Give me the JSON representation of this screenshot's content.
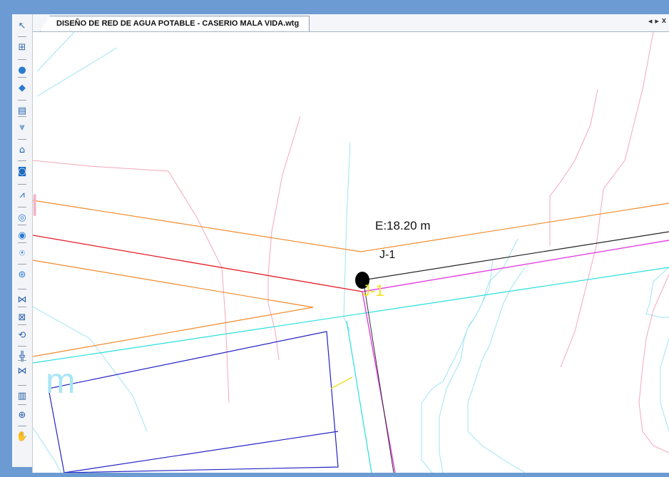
{
  "window": {
    "tab_title": "DISEÑO DE RED DE AGUA POTABLE - CASERIO MALA VIDA.wtg",
    "tab_controls": [
      "◂",
      "▸",
      "x"
    ]
  },
  "toolbar": {
    "tools": [
      {
        "name": "select-pointer-icon",
        "glyph": "↖"
      },
      {
        "name": "layout-icon",
        "glyph": "⊞"
      },
      {
        "name": "junction-icon",
        "glyph": "●"
      },
      {
        "name": "hydrant-icon",
        "glyph": "◆"
      },
      {
        "name": "tank-icon",
        "glyph": "▤"
      },
      {
        "name": "reservoir-icon",
        "glyph": "⩔"
      },
      {
        "name": "house-icon",
        "glyph": "⌂"
      },
      {
        "name": "pump-station-icon",
        "glyph": "◙"
      },
      {
        "name": "pipe-zigzag-icon",
        "glyph": "⩘"
      },
      {
        "name": "pump-icon",
        "glyph": "◎"
      },
      {
        "name": "valve-icon",
        "glyph": "◉"
      },
      {
        "name": "prv-icon",
        "glyph": "⍟"
      },
      {
        "name": "turbine-icon",
        "glyph": "⊛"
      },
      {
        "name": "valve-dropdown-icon",
        "glyph": "⋈"
      },
      {
        "name": "check-valve-icon",
        "glyph": "⊠"
      },
      {
        "name": "flow-control-icon",
        "glyph": "⟲"
      },
      {
        "name": "orifice-icon",
        "glyph": "╬"
      },
      {
        "name": "air-valve-icon",
        "glyph": "⋈"
      },
      {
        "name": "surge-tank-icon",
        "glyph": "▥"
      },
      {
        "name": "discharge-icon",
        "glyph": "⊕"
      },
      {
        "name": "pan-hand-icon",
        "glyph": "✋"
      }
    ]
  },
  "drawing": {
    "elevation_label": "E:18.20 m",
    "junction_label": "J-1",
    "junction_label_yellow": "J-1",
    "partial_label_m": "m",
    "partial_label_left": "l"
  }
}
